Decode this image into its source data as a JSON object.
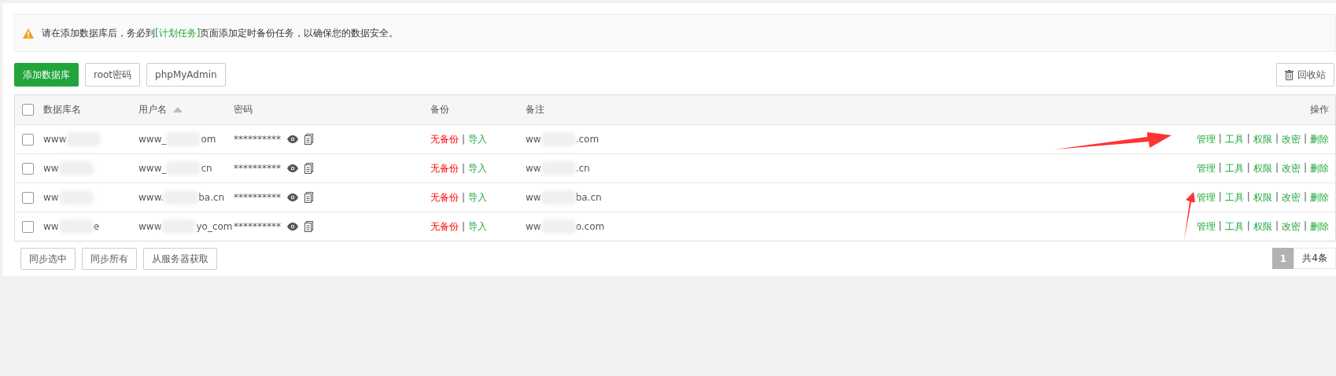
{
  "notice": {
    "before": "请在添加数据库后，务必到",
    "link": "[计划任务]",
    "after": "页面添加定时备份任务，以确保您的数据安全。"
  },
  "toolbar": {
    "buttons": [
      {
        "label": "添加数据库",
        "kind": "primary"
      },
      {
        "label": "root密码",
        "kind": "default"
      },
      {
        "label": "phpMyAdmin",
        "kind": "default"
      }
    ],
    "recycle": "回收站"
  },
  "table": {
    "select_all": {
      "checked": false
    },
    "separator": "|",
    "columns": [
      {
        "label": "数据库名",
        "sorted": false
      },
      {
        "label": "用户名",
        "sorted": true
      },
      {
        "label": "密码",
        "sorted": false
      },
      {
        "label": "备份",
        "sorted": false
      },
      {
        "label": "备注",
        "sorted": false
      },
      {
        "label": "操作",
        "sorted": false
      }
    ],
    "rows": [
      {
        "checked": false,
        "name": [
          "www"
        ],
        "user": [
          "www_",
          "om"
        ],
        "password": "**********",
        "backup": "无备份",
        "import": "导入",
        "remark": [
          "ww",
          ".com"
        ],
        "actions": [
          "管理",
          "工具",
          "权限",
          "改密",
          "删除"
        ]
      },
      {
        "checked": false,
        "name": [
          "ww"
        ],
        "user": [
          "www_",
          "cn"
        ],
        "password": "**********",
        "backup": "无备份",
        "import": "导入",
        "remark": [
          "ww",
          ".cn"
        ],
        "actions": [
          "管理",
          "工具",
          "权限",
          "改密",
          "删除"
        ]
      },
      {
        "checked": false,
        "name": [
          "ww"
        ],
        "user": [
          "www.",
          "ba.cn"
        ],
        "password": "**********",
        "backup": "无备份",
        "import": "导入",
        "remark": [
          "ww",
          "ba.cn"
        ],
        "actions": [
          "管理",
          "工具",
          "权限",
          "改密",
          "删除"
        ]
      },
      {
        "checked": false,
        "name": [
          "ww",
          "e"
        ],
        "user": [
          "www",
          "yo_com"
        ],
        "password": "**********",
        "backup": "无备份",
        "import": "导入",
        "remark": [
          "ww",
          "o.com"
        ],
        "actions": [
          "管理",
          "工具",
          "权限",
          "改密",
          "删除"
        ]
      }
    ]
  },
  "footer": {
    "buttons": [
      "同步选中",
      "同步所有",
      "从服务器获取"
    ],
    "pages": [
      {
        "label": "1",
        "selected": true
      }
    ],
    "total": "共4条"
  }
}
